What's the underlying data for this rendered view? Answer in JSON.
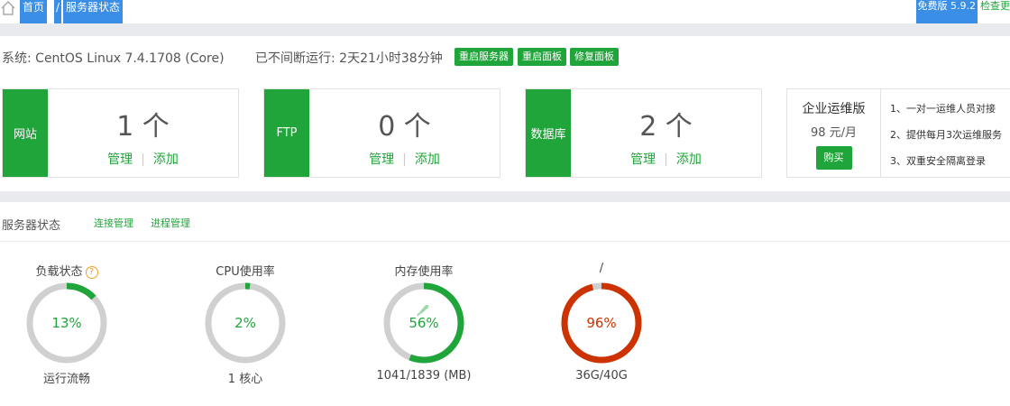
{
  "breadcrumb": {
    "home": "首页",
    "separator": "/",
    "current": "服务器状态"
  },
  "top_right": {
    "version": "免费版 5.9.2",
    "check_update": "检查更"
  },
  "system": {
    "os": "系统: CentOS Linux 7.4.1708 (Core)",
    "uptime": "已不间断运行: 2天21小时38分钟",
    "buttons": {
      "restart_server": "重启服务器",
      "restart_panel": "重启面板",
      "repair_panel": "修复面板"
    }
  },
  "cards": [
    {
      "tab": "网站",
      "count": "1 个",
      "manage": "管理",
      "sep": "|",
      "add": "添加"
    },
    {
      "tab": "FTP",
      "count": "0 个",
      "manage": "管理",
      "sep": "|",
      "add": "添加"
    },
    {
      "tab": "数据库",
      "count": "2 个",
      "manage": "管理",
      "sep": "|",
      "add": "添加"
    }
  ],
  "enterprise": {
    "title": "企业运维版",
    "price": "98 元/月",
    "buy": "购买",
    "features": [
      "1、一对一运维人员对接",
      "2、提供每月3次运维服务",
      "3、双重安全隔离登录"
    ]
  },
  "server_state": {
    "title": "服务器状态",
    "links": {
      "connection": "连接管理",
      "process": "进程管理"
    },
    "gauges": [
      {
        "label": "负载状态",
        "percent": 13,
        "display": "13%",
        "sub": "运行流畅",
        "color": "#20a53a",
        "help": "?"
      },
      {
        "label": "CPU使用率",
        "percent": 2,
        "display": "2%",
        "sub": "1 核心",
        "color": "#20a53a"
      },
      {
        "label": "内存使用率",
        "percent": 56,
        "display": "56%",
        "sub": "1041/1839 (MB)",
        "color": "#20a53a"
      },
      {
        "label": "/",
        "percent": 96,
        "display": "96%",
        "sub": "36G/40G",
        "color": "#cc3300"
      }
    ]
  }
}
